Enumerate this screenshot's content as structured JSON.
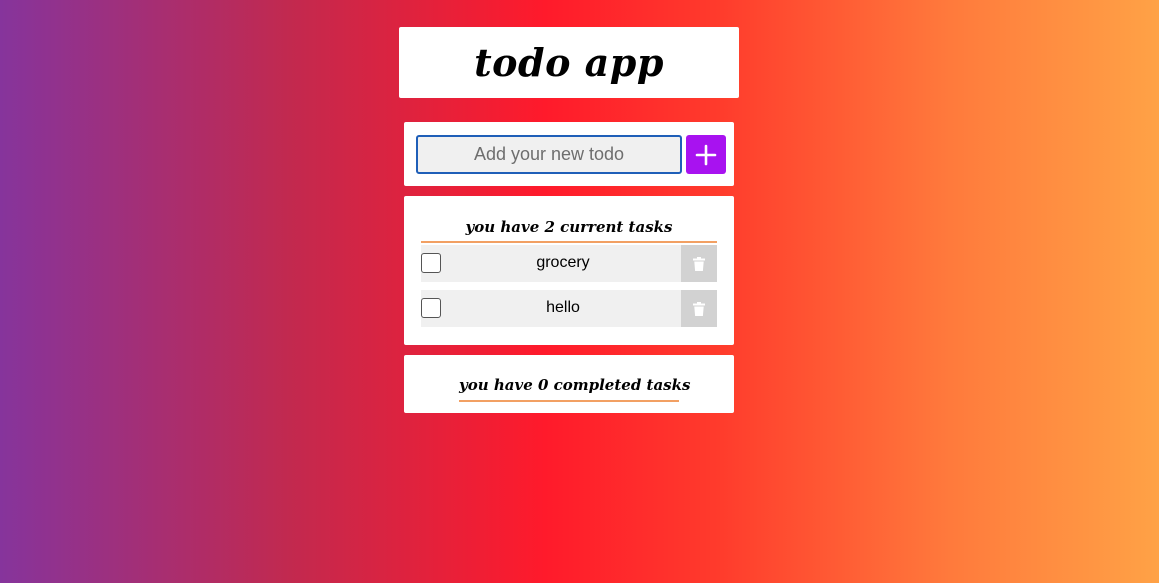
{
  "header": {
    "title": "todo app"
  },
  "new_todo": {
    "placeholder": "Add your new todo",
    "value": "",
    "add_icon": "plus-icon"
  },
  "current": {
    "heading": "you have 2 current tasks",
    "tasks": [
      {
        "label": "grocery",
        "checked": false,
        "delete_icon": "trash-icon"
      },
      {
        "label": "hello",
        "checked": false,
        "delete_icon": "trash-icon"
      }
    ]
  },
  "completed": {
    "heading": "you have 0 completed tasks",
    "tasks": []
  },
  "colors": {
    "add_button": "#a812f0",
    "heading_underline": "#f2a063",
    "input_border": "#1f5fb8",
    "gradient_start": "#86349c",
    "gradient_mid": "#ff1a2b",
    "gradient_end": "#ffa246"
  }
}
